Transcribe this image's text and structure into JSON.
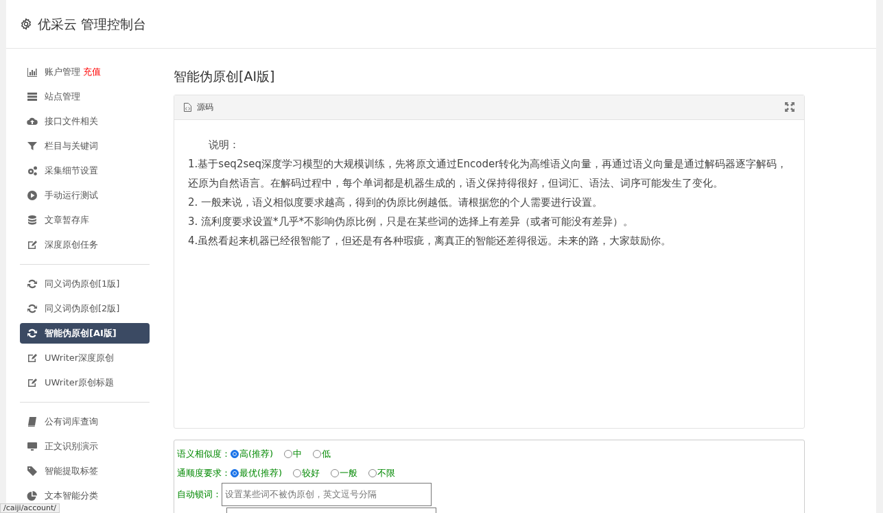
{
  "header": {
    "title": "优采云 管理控制台"
  },
  "sidebar": {
    "groups": [
      {
        "items": [
          {
            "label": "账户管理",
            "badge": "充值",
            "selected": false
          },
          {
            "label": "站点管理",
            "selected": false
          },
          {
            "label": "接口文件相关",
            "selected": false
          },
          {
            "label": "栏目与关键词",
            "selected": false
          },
          {
            "label": "采集细节设置",
            "selected": false
          },
          {
            "label": "手动运行测试",
            "selected": false
          },
          {
            "label": "文章暂存库",
            "selected": false
          },
          {
            "label": "深度原创任务",
            "selected": false
          }
        ]
      },
      {
        "items": [
          {
            "label": "同义词伪原创[1版]",
            "selected": false
          },
          {
            "label": "同义词伪原创[2版]",
            "selected": false
          },
          {
            "label": "智能伪原创[AI版]",
            "selected": true
          },
          {
            "label": "UWriter深度原创",
            "selected": false
          },
          {
            "label": "UWriter原创标题",
            "selected": false
          }
        ]
      },
      {
        "items": [
          {
            "label": "公有词库查询",
            "selected": false
          },
          {
            "label": "正文识别演示",
            "selected": false
          },
          {
            "label": "智能提取标签",
            "selected": false
          },
          {
            "label": "文本智能分类",
            "selected": false
          }
        ]
      }
    ]
  },
  "page_title": "智能伪原创[AI版]",
  "editor": {
    "tab": "源码",
    "paragraphs": [
      "说明：",
      "1.基于seq2seq深度学习模型的大规模训练，先将原文通过Encoder转化为高维语义向量，再通过语义向量是通过解码器逐字解码，还原为自然语言。在解码过程中，每个单词都是机器生成的，语义保持得很好，但词汇、语法、词序可能发生了变化。",
      "2. 一般来说，语义相似度要求越高，得到的伪原比例越低。请根据您的个人需要进行设置。",
      "3. 流利度要求设置*几乎*不影响伪原比例，只是在某些词的选择上有差异（或者可能没有差异）。",
      "4.虽然看起来机器已经很智能了，但还是有各种瑕疵，离真正的智能还差得很远。未来的路，大家鼓励你。"
    ]
  },
  "options": {
    "radio_groups": [
      {
        "label": "语义相似度：",
        "options": [
          {
            "label": "高(推荐)",
            "selected": true
          },
          {
            "label": "中",
            "selected": false
          },
          {
            "label": "低",
            "selected": false
          }
        ]
      },
      {
        "label": "通顺度要求：",
        "options": [
          {
            "label": "最优(推荐)",
            "selected": true
          },
          {
            "label": "较好",
            "selected": false
          },
          {
            "label": "一般",
            "selected": false
          },
          {
            "label": "不限",
            "selected": false
          }
        ]
      }
    ],
    "lock_words": {
      "label": "自动锁词：",
      "placeholder": "设置某些词不被伪原创，英文逗号分隔"
    }
  },
  "status_bar": {
    "url": "/caiji/account/"
  }
}
